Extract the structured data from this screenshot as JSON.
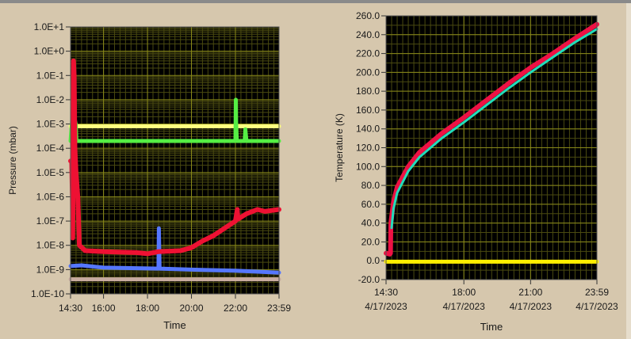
{
  "chart_data": [
    {
      "type": "line",
      "title": "",
      "xlabel": "Time",
      "ylabel": "Pressure (mbar)",
      "yscale": "log",
      "ylim": [
        1e-10,
        10
      ],
      "xlim": [
        "14:30",
        "23:59"
      ],
      "grid": true,
      "y_ticks": [
        "1.0E+1",
        "1.0E+0",
        "1.0E-1",
        "1.0E-2",
        "1.0E-3",
        "1.0E-4",
        "1.0E-5",
        "1.0E-6",
        "1.0E-7",
        "1.0E-8",
        "1.0E-9",
        "1.0E-10"
      ],
      "x_ticks": [
        "14:30",
        "16:00",
        "18:00",
        "20:00",
        "22:00",
        "23:59"
      ],
      "series": [
        {
          "name": "tan",
          "color": "#c8aba0",
          "points": [
            [
              "14:30",
              4e-10
            ],
            [
              "23:59",
              4e-10
            ]
          ]
        },
        {
          "name": "yellow",
          "color": "#ffff80",
          "points": [
            [
              "14:30",
              0.0008
            ],
            [
              "23:59",
              0.0008
            ]
          ]
        },
        {
          "name": "green",
          "color": "#55ee44",
          "points": [
            [
              "14:30",
              0.0002
            ],
            [
              "14:36",
              0.003
            ],
            [
              "14:38",
              0.4
            ],
            [
              "14:40",
              0.002
            ],
            [
              "14:44",
              0.001
            ],
            [
              "14:46",
              0.0002
            ],
            [
              "22:00",
              0.0002
            ],
            [
              "22:01",
              0.01
            ],
            [
              "22:02",
              0.001
            ],
            [
              "22:04",
              0.0002
            ],
            [
              "22:25",
              0.0002
            ],
            [
              "22:27",
              0.0006
            ],
            [
              "22:30",
              0.0002
            ],
            [
              "23:59",
              0.0002
            ]
          ]
        },
        {
          "name": "blue",
          "color": "#5577ff",
          "points": [
            [
              "14:30",
              1.4e-09
            ],
            [
              "15:00",
              1.5e-09
            ],
            [
              "16:00",
              1.2e-09
            ],
            [
              "18:30",
              1.1e-09
            ],
            [
              "18:31",
              5e-08
            ],
            [
              "18:33",
              1.1e-09
            ],
            [
              "20:00",
              1e-09
            ],
            [
              "22:00",
              9e-10
            ],
            [
              "23:59",
              7.5e-10
            ]
          ]
        },
        {
          "name": "red",
          "color": "#ee1133",
          "points": [
            [
              "14:30",
              3e-05
            ],
            [
              "14:33",
              3e-05
            ],
            [
              "14:35",
              1e-06
            ],
            [
              "14:36",
              2e-08
            ],
            [
              "14:37",
              1e-06
            ],
            [
              "14:38",
              0.4
            ],
            [
              "14:40",
              0.1
            ],
            [
              "14:42",
              0.0001
            ],
            [
              "14:45",
              1e-05
            ],
            [
              "14:50",
              1e-06
            ],
            [
              "14:54",
              1e-08
            ],
            [
              "15:10",
              6e-09
            ],
            [
              "16:00",
              5.5e-09
            ],
            [
              "17:30",
              5e-09
            ],
            [
              "18:00",
              4.5e-09
            ],
            [
              "18:30",
              5.5e-09
            ],
            [
              "19:30",
              6e-09
            ],
            [
              "20:00",
              8e-09
            ],
            [
              "20:30",
              1.5e-08
            ],
            [
              "21:00",
              2.5e-08
            ],
            [
              "21:30",
              5e-08
            ],
            [
              "22:00",
              1e-07
            ],
            [
              "22:05",
              3e-07
            ],
            [
              "22:07",
              1.2e-07
            ],
            [
              "22:30",
              2e-07
            ],
            [
              "23:00",
              3e-07
            ],
            [
              "23:20",
              2.5e-07
            ],
            [
              "23:59",
              3e-07
            ]
          ]
        }
      ]
    },
    {
      "type": "line",
      "title": "",
      "xlabel": "Time",
      "ylabel": "Temperature (K)",
      "yscale": "linear",
      "ylim": [
        -20,
        260
      ],
      "xlim": [
        "14:30",
        "23:59"
      ],
      "grid": true,
      "y_ticks": [
        "260.0",
        "240.0",
        "220.0",
        "200.0",
        "180.0",
        "160.0",
        "140.0",
        "120.0",
        "100.0",
        "80.0",
        "60.0",
        "40.0",
        "20.0",
        "0.0",
        "-20.0"
      ],
      "x_ticks": [
        {
          "time": "14:30",
          "date": "4/17/2023"
        },
        {
          "time": "18:00",
          "date": "4/17/2023"
        },
        {
          "time": "21:00",
          "date": "4/17/2023"
        },
        {
          "time": "23:59",
          "date": "4/17/2023"
        }
      ],
      "series": [
        {
          "name": "yellow",
          "color": "#ffee00",
          "points": [
            [
              "14:30",
              -1
            ],
            [
              "23:59",
              -1
            ]
          ]
        },
        {
          "name": "red",
          "color": "#ee1144",
          "points": [
            [
              "14:30",
              8
            ],
            [
              "14:40",
              7
            ],
            [
              "14:42",
              8
            ],
            [
              "14:43",
              40
            ],
            [
              "14:50",
              62
            ],
            [
              "15:00",
              78
            ],
            [
              "15:30",
              100
            ],
            [
              "16:00",
              115
            ],
            [
              "17:00",
              135
            ],
            [
              "18:00",
              152
            ],
            [
              "19:00",
              170
            ],
            [
              "20:00",
              188
            ],
            [
              "21:00",
              205
            ],
            [
              "22:00",
              220
            ],
            [
              "23:00",
              236
            ],
            [
              "23:59",
              251
            ]
          ]
        },
        {
          "name": "cyan",
          "color": "#22ddbb",
          "points": [
            [
              "14:45",
              35
            ],
            [
              "14:50",
              55
            ],
            [
              "15:00",
              72
            ],
            [
              "15:30",
              95
            ],
            [
              "16:00",
              110
            ],
            [
              "17:00",
              130
            ],
            [
              "18:00",
              147
            ],
            [
              "19:00",
              165
            ],
            [
              "20:00",
              183
            ],
            [
              "21:00",
              200
            ],
            [
              "22:00",
              216
            ],
            [
              "23:00",
              232
            ],
            [
              "23:59",
              246
            ]
          ]
        }
      ]
    }
  ]
}
